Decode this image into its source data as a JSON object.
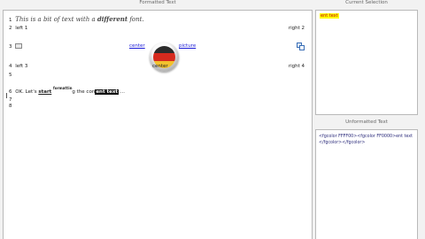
{
  "formatted_panel": {
    "title": "Formatted Text",
    "lines": [
      {
        "n": "1",
        "text_plain": "This is a bit of text with a ",
        "text_bold": "different",
        "text_end": " font."
      },
      {
        "n": "2",
        "left": "left 1",
        "right": "right 2"
      },
      {
        "n": "3",
        "center": "center",
        "picture": "picture"
      },
      {
        "n": "4",
        "left": "left 3",
        "right": "right 4",
        "center_label": "center"
      },
      {
        "n": "5"
      },
      {
        "n": "6",
        "text": "OK. Let's",
        "bold1": "start",
        "super": "formattin",
        "rest": "g the con",
        "highlight": "ent text",
        "tail": "..."
      },
      {
        "n": "7"
      },
      {
        "n": "8"
      }
    ]
  },
  "selection_panel": {
    "title": "Current Selection",
    "text": "ent text"
  },
  "unformatted_panel": {
    "title": "Unformatted Text",
    "text": "<fgcolor FFFF00><fgcolor FF0000>ent text</fgcolor></fgcolor>"
  },
  "colors": {
    "selection_bg": "#ffff00",
    "selection_fg": "#c00000",
    "link": "#1b1bd8"
  },
  "icons": [
    "image-icon",
    "copy-icon",
    "badge-flag-icon"
  ]
}
